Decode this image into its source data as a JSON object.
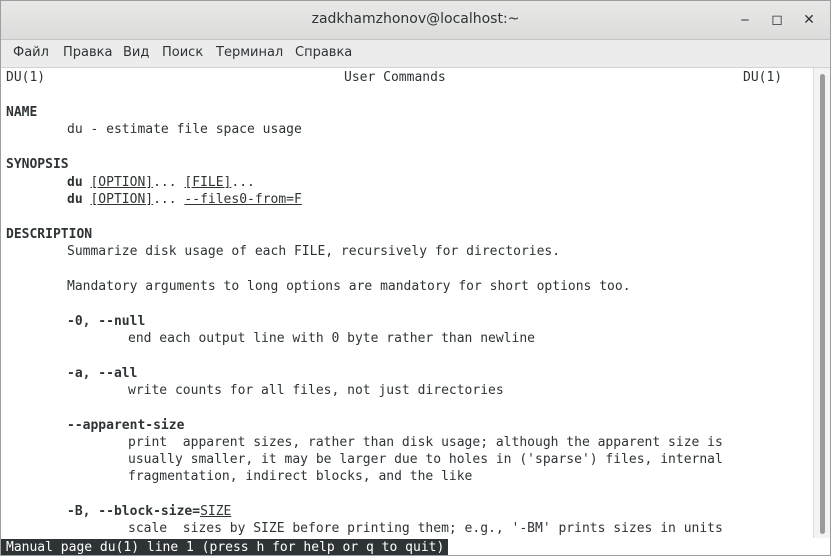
{
  "window": {
    "title": "zadkhamzhonov@localhost:~",
    "minimize_glyph": "‒",
    "maximize_glyph": "◻",
    "close_glyph": "✕"
  },
  "menubar": {
    "items": [
      "Файл",
      "Правка",
      "Вид",
      "Поиск",
      "Терминал",
      "Справка"
    ]
  },
  "man": {
    "header_left": "DU(1)",
    "header_center": "User Commands",
    "header_right": "DU(1)",
    "name_heading": "NAME",
    "name_line": "du - estimate file space usage",
    "synopsis_heading": "SYNOPSIS",
    "synopsis1": {
      "cmd": "du",
      "opt": "[OPTION]",
      "mid": "... ",
      "file": "[FILE]",
      "end": "..."
    },
    "synopsis2": {
      "cmd": "du",
      "opt": "[OPTION]",
      "mid": "... ",
      "flag": "--files0-from=F"
    },
    "description_heading": "DESCRIPTION",
    "desc1": "Summarize disk usage of each FILE, recursively for directories.",
    "desc2": "Mandatory arguments to long options are mandatory for short options too.",
    "opt_null": "-0, --null",
    "opt_null_desc": "end each output line with 0 byte rather than newline",
    "opt_all": "-a, --all",
    "opt_all_desc": "write counts for all files, not just directories",
    "opt_apparent": "--apparent-size",
    "opt_apparent_desc1": "print  apparent sizes, rather than disk usage; although the apparent size is",
    "opt_apparent_desc2": "usually smaller, it may be larger due to holes in ('sparse') files, internal",
    "opt_apparent_desc3": "fragmentation, indirect blocks, and the like",
    "opt_block_prefix": "-B, --block-size=",
    "opt_block_arg": "SIZE",
    "opt_block_desc": "scale  sizes by SIZE before printing them; e.g., '-BM' prints sizes in units"
  },
  "status": {
    "text": "Manual page du(1) line 1 (press h for help or q to quit)"
  }
}
